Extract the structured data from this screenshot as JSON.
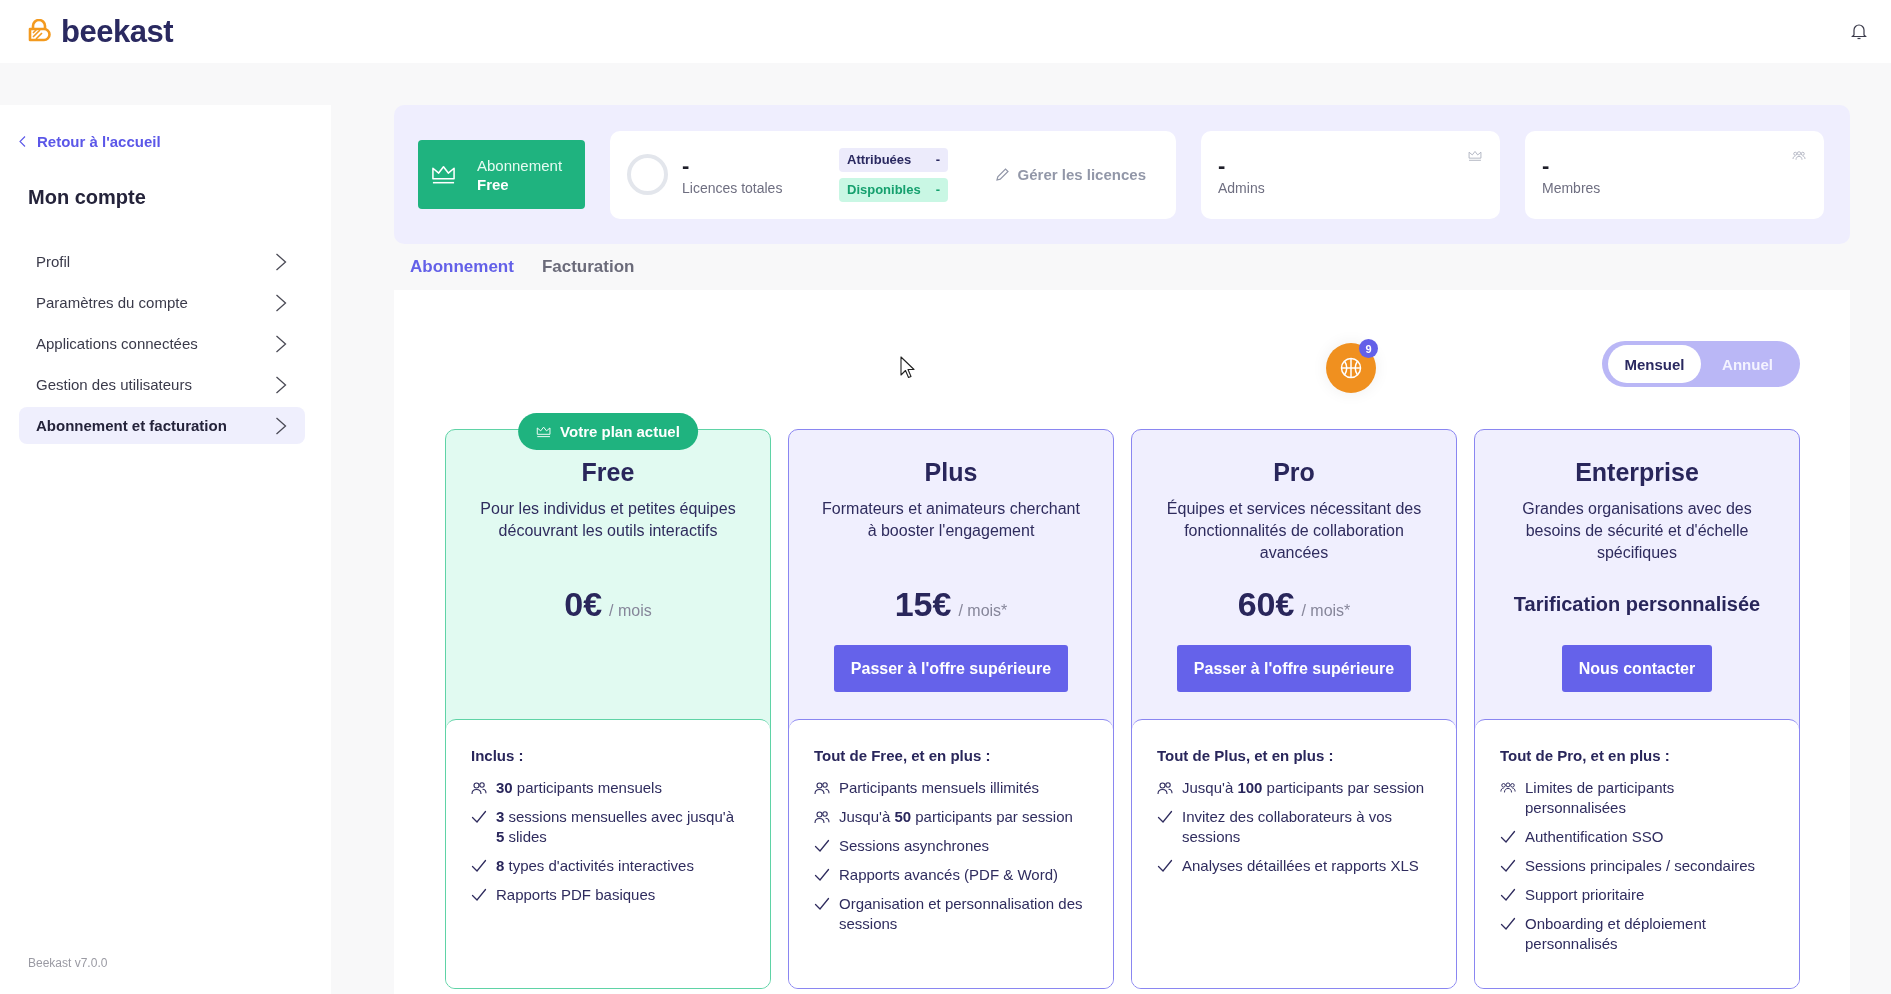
{
  "header": {
    "logo_text": "beekast"
  },
  "sidebar": {
    "back_link": "Retour à l'accueil",
    "title": "Mon compte",
    "items": [
      {
        "label": "Profil",
        "selected": false
      },
      {
        "label": "Paramètres du compte",
        "selected": false
      },
      {
        "label": "Applications connectées",
        "selected": false
      },
      {
        "label": "Gestion des utilisateurs",
        "selected": false
      },
      {
        "label": "Abonnement et facturation",
        "selected": true
      }
    ],
    "version": "Beekast v7.0.0"
  },
  "summary": {
    "plan": {
      "label": "Abonnement",
      "name": "Free"
    },
    "licences": {
      "value": "-",
      "label": "Licences totales",
      "breakdown": [
        {
          "label": "Attribuées",
          "value": "-",
          "kind": "assigned"
        },
        {
          "label": "Disponibles",
          "value": "-",
          "kind": "available"
        }
      ],
      "manage_button": {
        "label": "Gérer les licences",
        "disabled": true
      }
    },
    "stats": [
      {
        "value": "-",
        "label": "Admins",
        "kind": "admins"
      },
      {
        "value": "-",
        "label": "Membres",
        "kind": "members"
      }
    ]
  },
  "tabs": [
    {
      "label": "Abonnement",
      "selected": true
    },
    {
      "label": "Facturation",
      "selected": false
    }
  ],
  "help_widget": {
    "count": "9"
  },
  "billing_toggle": [
    {
      "label": "Mensuel",
      "selected": true
    },
    {
      "label": "Annuel",
      "selected": false
    }
  ],
  "plans": [
    {
      "name": "Free",
      "current": true,
      "current_badge": "Votre plan actuel",
      "description": "Pour les individus et petites équipes découvrant les outils interactifs",
      "price": {
        "kind": "amount",
        "amount": "0€",
        "period": "/ mois"
      },
      "features_title": "Inclus :",
      "features": [
        {
          "kind": "people",
          "text": "**30** participants mensuels"
        },
        {
          "kind": "check",
          "text": "**3** sessions mensuelles avec jusqu'à **5** slides"
        },
        {
          "kind": "check",
          "text": "**8** types d'activités interactives"
        },
        {
          "kind": "check",
          "text": "Rapports PDF basiques"
        }
      ]
    },
    {
      "name": "Plus",
      "current": false,
      "description": "Formateurs et animateurs cherchant à booster l'engagement",
      "price": {
        "kind": "amount",
        "amount": "15€",
        "period": "/ mois*"
      },
      "button": "Passer à l'offre supérieure",
      "features_title": "Tout de Free, et en plus :",
      "features": [
        {
          "kind": "people",
          "text": "Participants mensuels illimités"
        },
        {
          "kind": "people",
          "text": "Jusqu'à **50** participants par session"
        },
        {
          "kind": "check",
          "text": "Sessions asynchrones"
        },
        {
          "kind": "check",
          "text": "Rapports avancés (PDF & Word)"
        },
        {
          "kind": "check",
          "text": "Organisation et personnalisation des sessions"
        }
      ]
    },
    {
      "name": "Pro",
      "current": false,
      "description": "Équipes et services nécessitant des fonctionnalités de collaboration avancées",
      "price": {
        "kind": "amount",
        "amount": "60€",
        "period": "/ mois*"
      },
      "button": "Passer à l'offre supérieure",
      "features_title": "Tout de Plus, et en plus :",
      "features": [
        {
          "kind": "people",
          "text": "Jusqu'à **100** participants par session"
        },
        {
          "kind": "check",
          "text": "Invitez des collaborateurs à vos sessions"
        },
        {
          "kind": "check",
          "text": "Analyses détaillées et rapports XLS"
        }
      ]
    },
    {
      "name": "Enterprise",
      "current": false,
      "description": "Grandes organisations avec des besoins de sécurité et d'échelle spécifiques",
      "price": {
        "kind": "custom",
        "text": "Tarification personnalisée"
      },
      "button": "Nous contacter",
      "features_title": "Tout de Pro, et en plus :",
      "features": [
        {
          "kind": "group",
          "text": "Limites de participants personnalisées"
        },
        {
          "kind": "check",
          "text": "Authentification SSO"
        },
        {
          "kind": "check",
          "text": "Sessions principales / secondaires"
        },
        {
          "kind": "check",
          "text": "Support prioritaire"
        },
        {
          "kind": "check",
          "text": "Onboarding et déploiement personnalisés"
        }
      ]
    }
  ]
}
